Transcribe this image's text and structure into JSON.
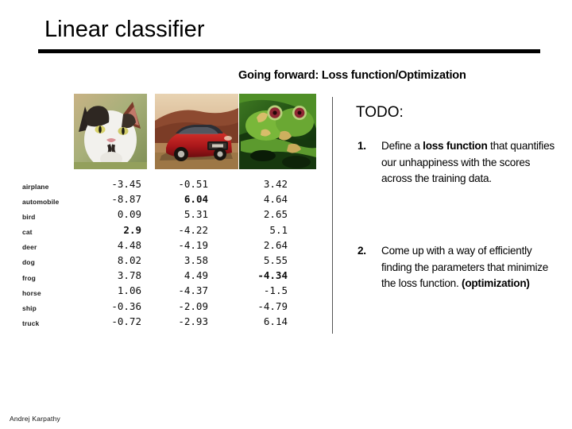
{
  "slide": {
    "title": "Linear classifier",
    "subtitle": "Going forward: Loss function/Optimization",
    "footer_author": "Andrej Karpathy"
  },
  "thumbnails": [
    {
      "name": "cat-image",
      "alt": "cat"
    },
    {
      "name": "car-image",
      "alt": "red car"
    },
    {
      "name": "frog-image",
      "alt": "tree frogs"
    }
  ],
  "score_table": {
    "classes": [
      "airplane",
      "automobile",
      "bird",
      "cat",
      "deer",
      "dog",
      "frog",
      "horse",
      "ship",
      "truck"
    ],
    "columns": [
      {
        "image": "cat",
        "values": [
          "-3.45",
          "-8.87",
          "0.09",
          "2.9",
          "4.48",
          "8.02",
          "3.78",
          "1.06",
          "-0.36",
          "-0.72"
        ],
        "bold_index": 3
      },
      {
        "image": "car",
        "values": [
          "-0.51",
          "6.04",
          "5.31",
          "-4.22",
          "-4.19",
          "3.58",
          "4.49",
          "-4.37",
          "-2.09",
          "-2.93"
        ],
        "bold_index": 1
      },
      {
        "image": "frog",
        "values": [
          "3.42",
          "4.64",
          "2.65",
          "5.1",
          "2.64",
          "5.55",
          "-4.34",
          "-1.5",
          "-4.79",
          "6.14"
        ],
        "bold_index": 6
      }
    ]
  },
  "todo": {
    "heading": "TODO:",
    "items": [
      {
        "number": "1.",
        "parts": [
          {
            "text": "Define a ",
            "bold": false
          },
          {
            "text": "loss function",
            "bold": true
          },
          {
            "text": " that quantifies our unhappiness with the scores across the training data.",
            "bold": false
          }
        ]
      },
      {
        "number": "2.",
        "parts": [
          {
            "text": "Come up with a way of efficiently finding the parameters that minimize the loss function. ",
            "bold": false
          },
          {
            "text": "(optimization)",
            "bold": true
          }
        ]
      }
    ]
  },
  "colors": {
    "background": "#ffffff",
    "text": "#000000",
    "rule": "#000000",
    "divider": "#555555"
  }
}
